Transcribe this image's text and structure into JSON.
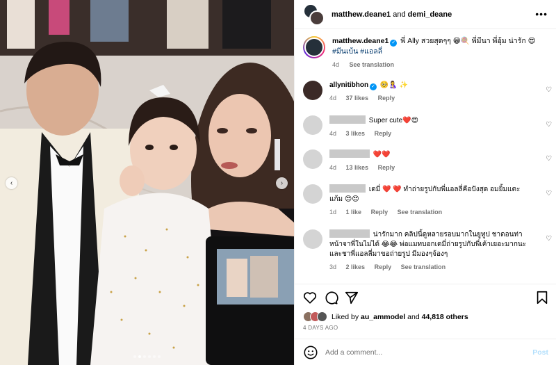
{
  "header": {
    "user1": "matthew.deane1",
    "joiner": "and",
    "user2": "demi_deane",
    "more_label": "•••"
  },
  "caption": {
    "username": "matthew.deane1",
    "verified_glyph": "✓",
    "text": "พี่ Ally สวยสุดๆๆ 😁🍭 พี่มีนา พี่อุ้ม น่ารัก 😍",
    "hashtags": "#มีนเบ้น #แอลลี่",
    "time": "4d",
    "see_translation": "See translation"
  },
  "comments": [
    {
      "username": "allynitibhon",
      "verified_glyph": "✓",
      "text": " 🥺🤱 ✨",
      "time": "4d",
      "likes": "37 likes",
      "reply": "Reply",
      "heart_icon": "heart-outline-icon"
    },
    {
      "text": "Super cute❤️😍",
      "time": "4d",
      "likes": "3 likes",
      "reply": "Reply",
      "heart_icon": "heart-outline-icon"
    },
    {
      "text": "❤️❤️",
      "time": "4d",
      "likes": "13 likes",
      "reply": "Reply",
      "heart_icon": "heart-outline-icon"
    },
    {
      "text": "เดมี่ ❤️ ❤️ ทำถ่ายรูปกับพี่แอลลี่คือปังสุด อมยิ้มแตะแก้ม 😍😍",
      "time": "1d",
      "likes": "1 like",
      "reply": "Reply",
      "see_translation": "See translation",
      "heart_icon": "heart-outline-icon"
    },
    {
      "text": "น่ารักมาก คลิปนี้ดูหลายรอบมากในยูทูป ชาดอนท่าหน้าจาพี่ในไม่ได้ 😂😂 พ่อแมทบอกเดมี่ถ่ายรูปกับพี่เค้าเยอะมากนะ และชาพี่แอลลี่มาขอถ่ายรูป มีมองๆจ้องๆ",
      "time": "3d",
      "likes": "2 likes",
      "reply": "Reply",
      "see_translation": "See translation",
      "heart_icon": "heart-outline-icon"
    }
  ],
  "likes": {
    "prefix": "Liked by",
    "user": "au_ammodel",
    "joiner": "and",
    "others": "44,818 others"
  },
  "time_ago": "4 DAYS AGO",
  "add_comment": {
    "placeholder": "Add a comment...",
    "post_label": "Post"
  },
  "carousel": {
    "prev_glyph": "‹",
    "next_glyph": "›",
    "total_dots": 6,
    "active_dot": 1
  },
  "colors": {
    "accent_blue": "#0095f6",
    "post_disabled": "#b2dffc",
    "meta_gray": "#737373",
    "hashtag": "#00376b"
  }
}
